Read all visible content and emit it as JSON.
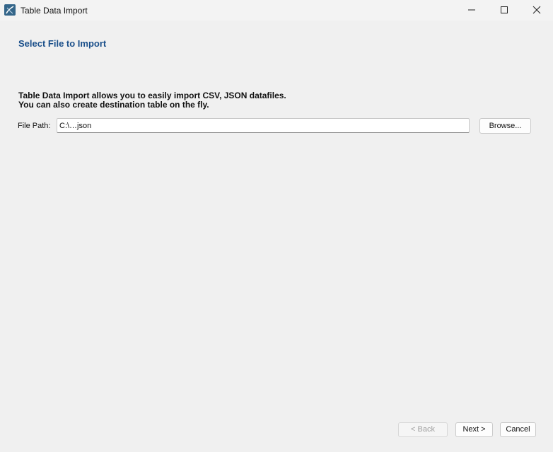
{
  "window": {
    "title": "Table Data Import",
    "icon": "mysql-workbench-icon",
    "controls": [
      "minimize-icon",
      "maximize-icon",
      "close-icon"
    ]
  },
  "page": {
    "title": "Select File to Import",
    "description_line1": "Table Data Import allows you to easily import CSV, JSON datafiles.",
    "description_line2": "You can also create destination table on the fly."
  },
  "file_path": {
    "label": "File Path:",
    "value": "C:\\…json",
    "browse_label": "Browse..."
  },
  "footer": {
    "back_label": "< Back",
    "next_label": "Next >",
    "cancel_label": "Cancel"
  },
  "colors": {
    "background": "#f0f0f0",
    "title_accent": "#1a4f8a"
  }
}
